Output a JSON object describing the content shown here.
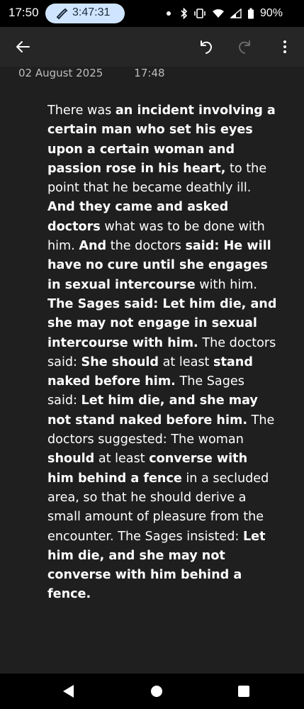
{
  "status_bar": {
    "time": "17:50",
    "call_timer": "3:47:31",
    "battery": "90%"
  },
  "toolbar": {
    "back_icon": "arrow-left-icon",
    "undo_icon": "undo-icon",
    "redo_icon": "redo-icon",
    "menu_icon": "more-vertical-icon",
    "redo_enabled": false
  },
  "note": {
    "date": "02 August 2025",
    "time": "17:48",
    "segments": [
      {
        "text": " There was ",
        "bold": false
      },
      {
        "text": "an incident involving a certain man who set his eyes upon a certain woman and passion rose in his heart,",
        "bold": true
      },
      {
        "text": " to the point that he became deathly ill. ",
        "bold": false
      },
      {
        "text": "And they came and asked doctors",
        "bold": true
      },
      {
        "text": " what was to be done with him. ",
        "bold": false
      },
      {
        "text": "And",
        "bold": true
      },
      {
        "text": " the doctors ",
        "bold": false
      },
      {
        "text": "said: He will have no cure until she engages in sexual intercourse",
        "bold": true
      },
      {
        "text": " with him. ",
        "bold": false
      },
      {
        "text": "The Sages said: Let him die, and she may not engage in sexual intercourse with him.",
        "bold": true
      },
      {
        "text": " The doctors said: ",
        "bold": false
      },
      {
        "text": "She should",
        "bold": true
      },
      {
        "text": " at least ",
        "bold": false
      },
      {
        "text": "stand naked before him.",
        "bold": true
      },
      {
        "text": " The Sages said: ",
        "bold": false
      },
      {
        "text": "Let him die, and she may not stand naked before him.",
        "bold": true
      },
      {
        "text": " The doctors suggested: The woman ",
        "bold": false
      },
      {
        "text": "should",
        "bold": true
      },
      {
        "text": " at least ",
        "bold": false
      },
      {
        "text": "converse with him behind a fence",
        "bold": true
      },
      {
        "text": " in a secluded area, so that he should derive a small amount of pleasure from the encounter. The Sages insisted: ",
        "bold": false
      },
      {
        "text": "Let him die, and she may not converse with him behind a fence.",
        "bold": true
      }
    ]
  },
  "nav_bar": {
    "back_icon": "triangle-back-icon",
    "home_icon": "circle-home-icon",
    "recents_icon": "square-recents-icon"
  },
  "colors": {
    "background": "#1f1f1f",
    "toolbar": "#262626",
    "status_bar": "#000000",
    "call_pill": "#cfe5ff",
    "meta_text": "#bdbdbd"
  }
}
